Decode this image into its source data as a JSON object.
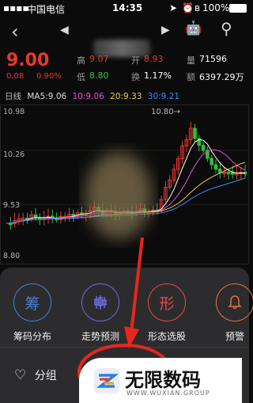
{
  "status_bar": {
    "carrier": "中国电信",
    "time": "14:35",
    "battery": "100%"
  },
  "nav": {
    "back_icon": "chevron-left-icon",
    "prev_icon": "triangle-left-icon",
    "next_icon": "triangle-right-icon",
    "robot_icon": "robot-icon",
    "search_icon": "search-icon"
  },
  "quote": {
    "price": "9.00",
    "change": "0.08",
    "change_pct": "0.90%",
    "high_label": "高",
    "high": "9.07",
    "open_label": "开",
    "open": "8.93",
    "volume_label": "量",
    "volume": "71596",
    "low_label": "低",
    "low": "8.80",
    "turnover_label": "换",
    "turnover": "1.17%",
    "amount_label": "额",
    "amount": "6397.29万"
  },
  "indicators": {
    "period": "日线",
    "ma5": "MA5:9.06",
    "ma10": "10:9.06",
    "ma20": "20:9.33",
    "ma30": "30:9.21"
  },
  "chart_data": {
    "type": "candlestick",
    "y_ticks": [
      "10.98",
      "10.26",
      "9.53",
      "8.80"
    ],
    "high_annotation": "10.80→",
    "colors": {
      "up": "#e8382e",
      "down": "#2fbf3a",
      "ma5": "#ffffff",
      "ma10": "#e84fd1",
      "ma20": "#f2c94c",
      "ma30": "#3a8bff"
    }
  },
  "actions": [
    {
      "label": "筹码分布",
      "glyph": "筹",
      "color": "#4a7fd6",
      "icon": "chips-icon"
    },
    {
      "label": "走势预测",
      "glyph": "",
      "color": "#6f6ad6",
      "icon": "candlestick-icon"
    },
    {
      "label": "形态选股",
      "glyph": "形",
      "color": "#e24a4a",
      "icon": "pattern-icon"
    },
    {
      "label": "预警",
      "glyph": "",
      "color": "#e2703a",
      "icon": "bell-icon"
    }
  ],
  "group": {
    "label": "分组",
    "icon": "heart-icon"
  },
  "watermark": {
    "title": "无限数码",
    "subtitle": "WWW.WUXIAN.GROUP"
  }
}
